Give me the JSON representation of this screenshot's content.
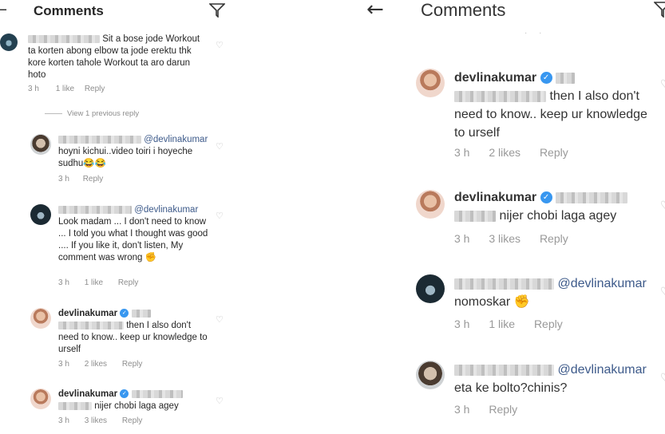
{
  "left": {
    "header": {
      "title": "Comments",
      "back_icon": "←"
    },
    "comments": [
      {
        "text": "Sit a bose jode Workout ta korten abong elbow ta jode erektu thk kore korten tahole Workout ta aro darun hoto",
        "time": "3 h",
        "likes": "1 like",
        "reply": "Reply"
      },
      {
        "mention": "@devlinakumar",
        "text": "hoyni kichui..video toiri i hoyeche sudhu😂😂",
        "time": "3 h",
        "reply": "Reply"
      },
      {
        "mention": "@devlinakumar",
        "text": "Look madam ... I don't need to know ... I told you what I thought was good .... If you like it, don't listen, My comment was wrong ✊",
        "time": "3 h",
        "likes": "1 like",
        "reply": "Reply"
      },
      {
        "username": "devlinakumar",
        "text": "then I also don't need to know.. keep ur knowledge to urself",
        "time": "3 h",
        "likes": "2 likes",
        "reply": "Reply"
      },
      {
        "username": "devlinakumar",
        "text": "nijer chobi laga agey",
        "time": "3 h",
        "likes": "3 likes",
        "reply": "Reply"
      }
    ],
    "view_previous": "View 1 previous reply"
  },
  "right": {
    "header": {
      "title": "Comments",
      "back_icon": "←"
    },
    "comments": [
      {
        "username": "devlinakumar",
        "text": "then I also don't need to know.. keep ur knowledge to urself",
        "time": "3 h",
        "likes": "2 likes",
        "reply": "Reply"
      },
      {
        "username": "devlinakumar",
        "text": "nijer chobi laga agey",
        "time": "3 h",
        "likes": "3 likes",
        "reply": "Reply"
      },
      {
        "mention": "@devlinakumar",
        "text": "nomoskar ✊",
        "time": "3 h",
        "likes": "1 like",
        "reply": "Reply"
      },
      {
        "mention": "@devlinakumar",
        "text": "eta ke bolto?chinis?",
        "time": "3 h",
        "reply": "Reply"
      }
    ]
  },
  "colors": {
    "verified": "#3897f0",
    "mention": "#3d5a8a",
    "meta": "#8e8e8e"
  },
  "icons": {
    "back": "back-arrow-icon",
    "filter": "filter-icon",
    "heart": "heart-icon",
    "verified": "verified-badge-icon"
  }
}
